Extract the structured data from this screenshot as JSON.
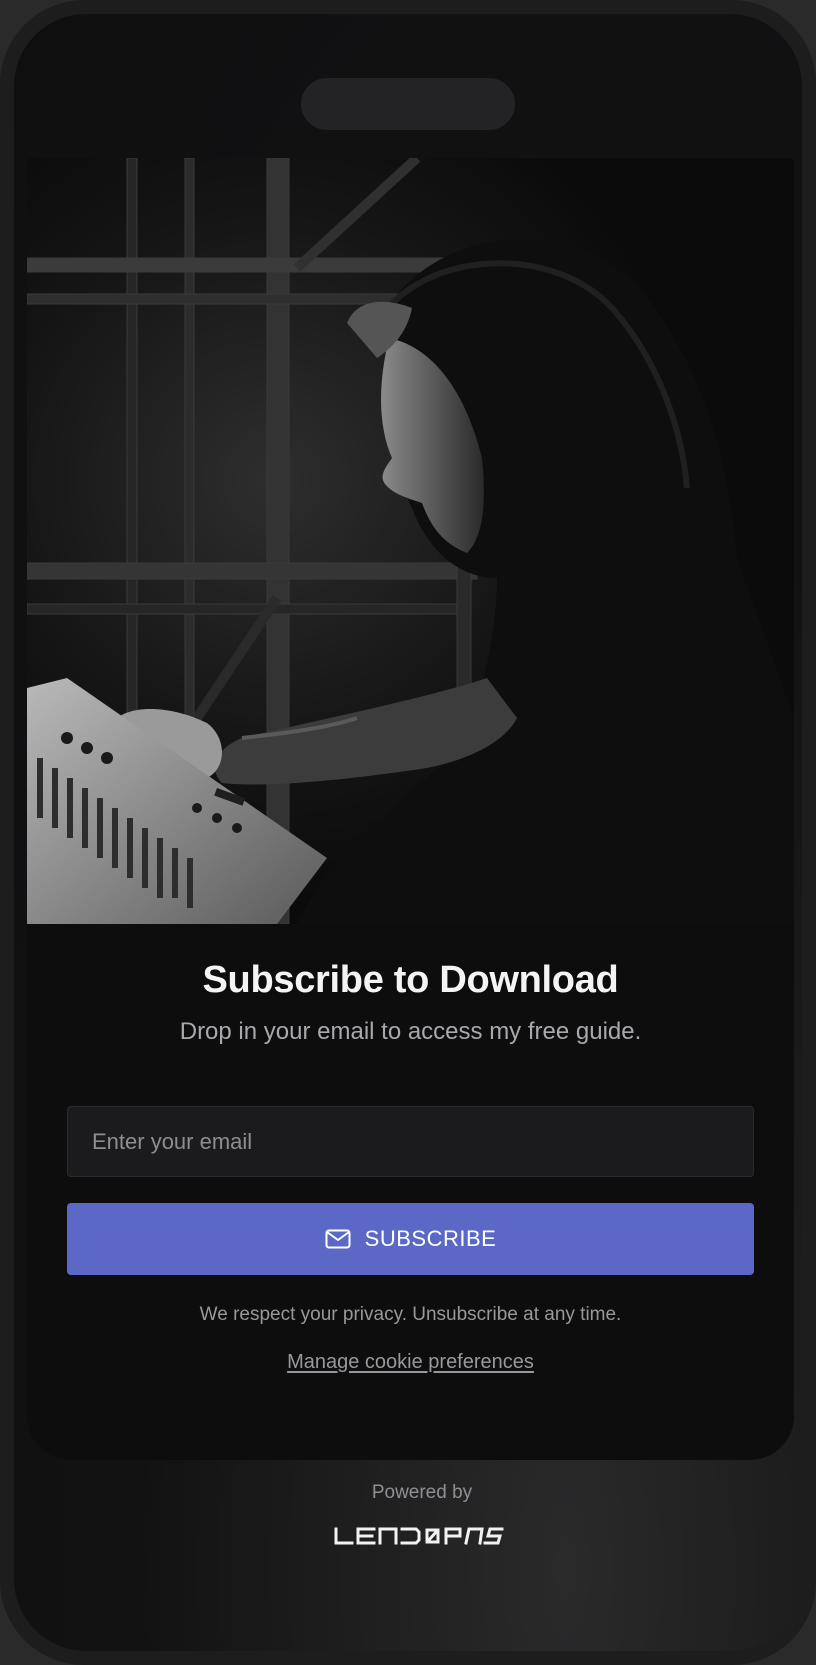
{
  "form": {
    "title": "Subscribe to Download",
    "subtitle": "Drop in your email to access my free guide.",
    "email_placeholder": "Enter your email",
    "email_value": "",
    "subscribe_label": "SUBSCRIBE",
    "subscribe_icon": "mail-icon",
    "privacy_text": "We respect your privacy. Unsubscribe at any time.",
    "cookie_link": "Manage cookie preferences"
  },
  "footer": {
    "powered_by": "Powered by",
    "brand": "LEAD PASS"
  },
  "hero": {
    "image_description": "monochrome photo of a hooded man adjusting a mixing console"
  },
  "colors": {
    "accent": "#5c68c6",
    "card_bg": "#0d0d0e",
    "frame": "#1d1d1e"
  }
}
